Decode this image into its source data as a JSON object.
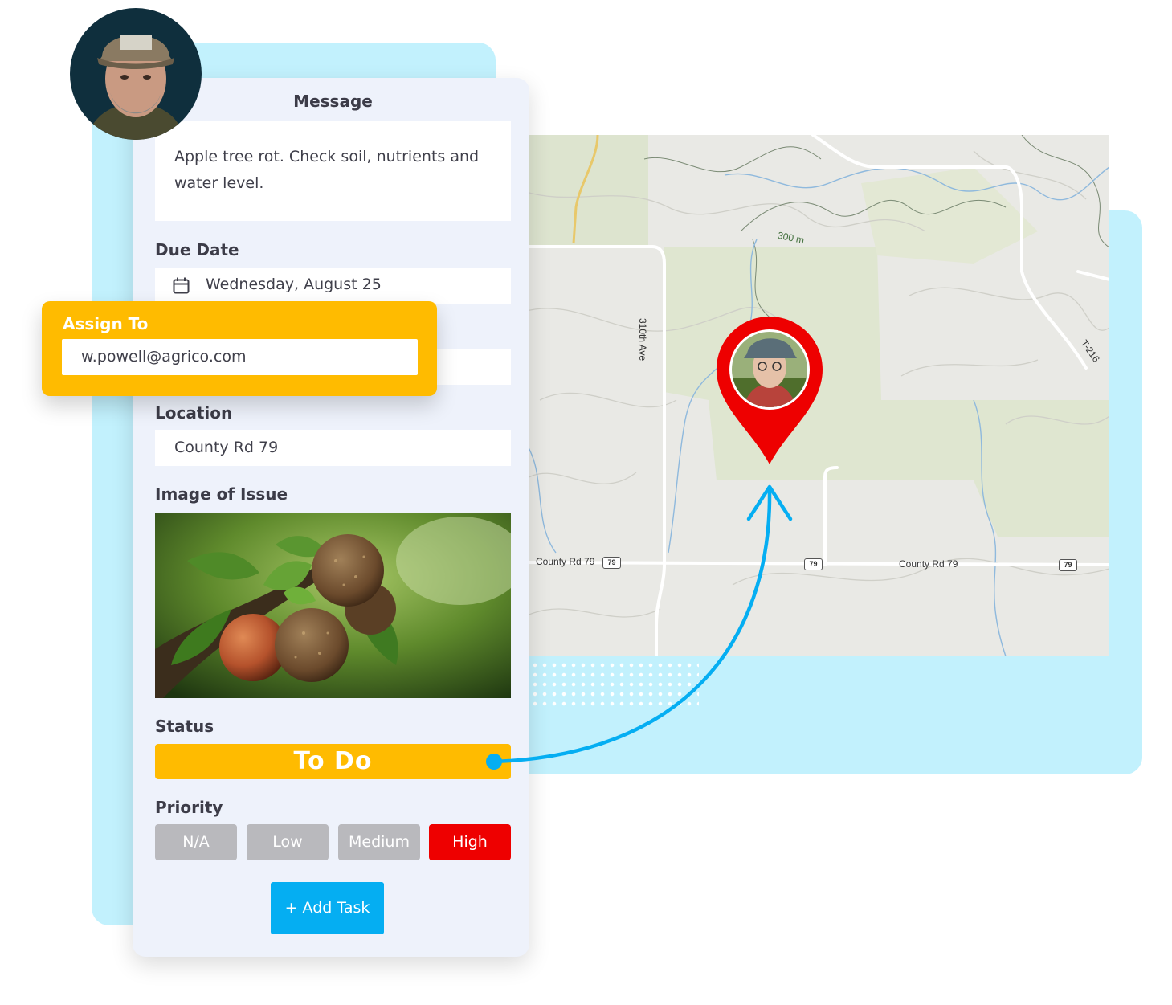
{
  "form": {
    "message_heading": "Message",
    "message_text": "Apple tree rot. Check soil, nutrients and water level.",
    "due_date_label": "Due Date",
    "due_date_value": "Wednesday, August 25",
    "location_label": "Location",
    "location_value": "County Rd 79",
    "image_label": "Image of Issue",
    "status_label": "Status",
    "status_value": "To Do",
    "priority_label": "Priority",
    "priority_options": [
      "N/A",
      "Low",
      "Medium",
      "High"
    ],
    "priority_selected": "High",
    "add_task_label": "+ Add Task"
  },
  "assign": {
    "label": "Assign To",
    "value": "w.powell@agrico.com"
  },
  "map": {
    "labels": {
      "road_310th": "310th Ave",
      "contour_300m": "300 m",
      "road_t216": "T-216",
      "county_rd_left": "County Rd 79",
      "county_rd_right": "County Rd 79",
      "shield_1": "79",
      "shield_2": "79",
      "shield_3": "79"
    }
  },
  "colors": {
    "accent_yellow": "#ffbb00",
    "accent_blue": "#05aef2",
    "priority_high": "#ee0000",
    "priority_inactive": "#b9b9bd",
    "pin_red": "#ee0000",
    "background_cyan": "#c2f1fd"
  }
}
